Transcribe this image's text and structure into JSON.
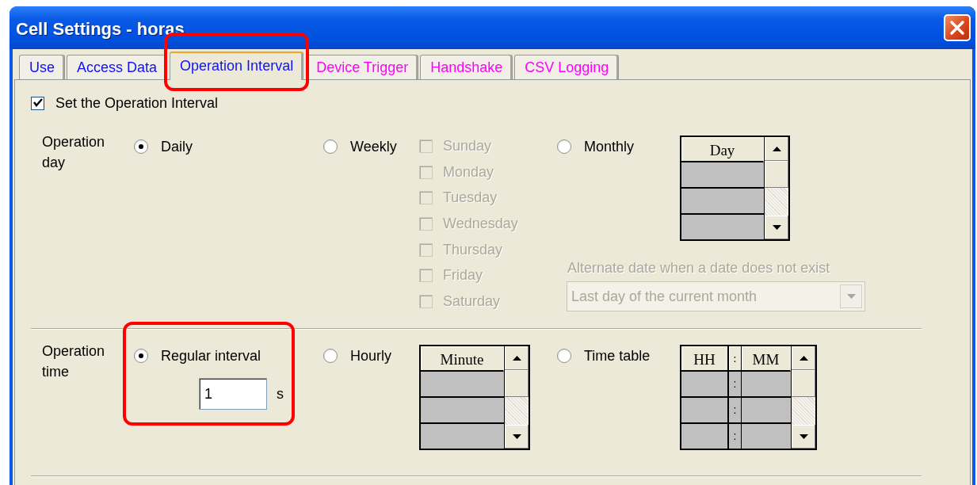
{
  "window": {
    "title": "Cell Settings - horas"
  },
  "tabs": [
    {
      "label": "Use",
      "selected": false,
      "color": "#1010ff",
      "highlighted": false
    },
    {
      "label": "Access Data",
      "selected": false,
      "color": "#1010ff",
      "highlighted": false
    },
    {
      "label": "Operation Interval",
      "selected": true,
      "color": "#1010ff",
      "highlighted": true
    },
    {
      "label": "Device Trigger",
      "selected": false,
      "color": "#ff00ff",
      "highlighted": false
    },
    {
      "label": "Handshake",
      "selected": false,
      "color": "#ff00ff",
      "highlighted": false
    },
    {
      "label": "CSV Logging",
      "selected": false,
      "color": "#ff00ff",
      "highlighted": false
    }
  ],
  "set_interval": {
    "label": "Set the Operation Interval",
    "checked": true
  },
  "operation_day": {
    "label": "Operation day",
    "options": [
      {
        "kind": "daily",
        "label": "Daily",
        "selected": true
      },
      {
        "kind": "weekly",
        "label": "Weekly",
        "selected": false,
        "days": [
          {
            "label": "Sunday",
            "checked": false,
            "disabled": true
          },
          {
            "label": "Monday",
            "checked": false,
            "disabled": true
          },
          {
            "label": "Tuesday",
            "checked": false,
            "disabled": true
          },
          {
            "label": "Wednesday",
            "checked": false,
            "disabled": true
          },
          {
            "label": "Thursday",
            "checked": false,
            "disabled": true
          },
          {
            "label": "Friday",
            "checked": false,
            "disabled": true
          },
          {
            "label": "Saturday",
            "checked": false,
            "disabled": true
          }
        ]
      },
      {
        "kind": "monthly",
        "label": "Monthly",
        "selected": false,
        "grid": {
          "columns": [
            "Day"
          ],
          "rows": [
            [
              null
            ],
            [
              null
            ],
            [
              null
            ]
          ]
        },
        "alternate": {
          "label": "Alternate date when a date does not exist",
          "value": "Last day of the current month",
          "disabled": true
        }
      }
    ]
  },
  "operation_time": {
    "label": "Operation time",
    "options": [
      {
        "kind": "regular",
        "label": "Regular interval",
        "selected": true,
        "value": "1",
        "unit": "s",
        "highlighted": true
      },
      {
        "kind": "hourly",
        "label": "Hourly",
        "selected": false,
        "grid": {
          "columns": [
            "Minute"
          ],
          "rows": [
            [
              null
            ],
            [
              null
            ],
            [
              null
            ]
          ]
        }
      },
      {
        "kind": "timetable",
        "label": "Time table",
        "selected": false,
        "grid": {
          "columns": [
            "HH",
            ":",
            "MM"
          ],
          "rows": [
            [
              null,
              ":",
              null
            ],
            [
              null,
              ":",
              null
            ],
            [
              null,
              ":",
              null
            ]
          ]
        }
      }
    ]
  }
}
